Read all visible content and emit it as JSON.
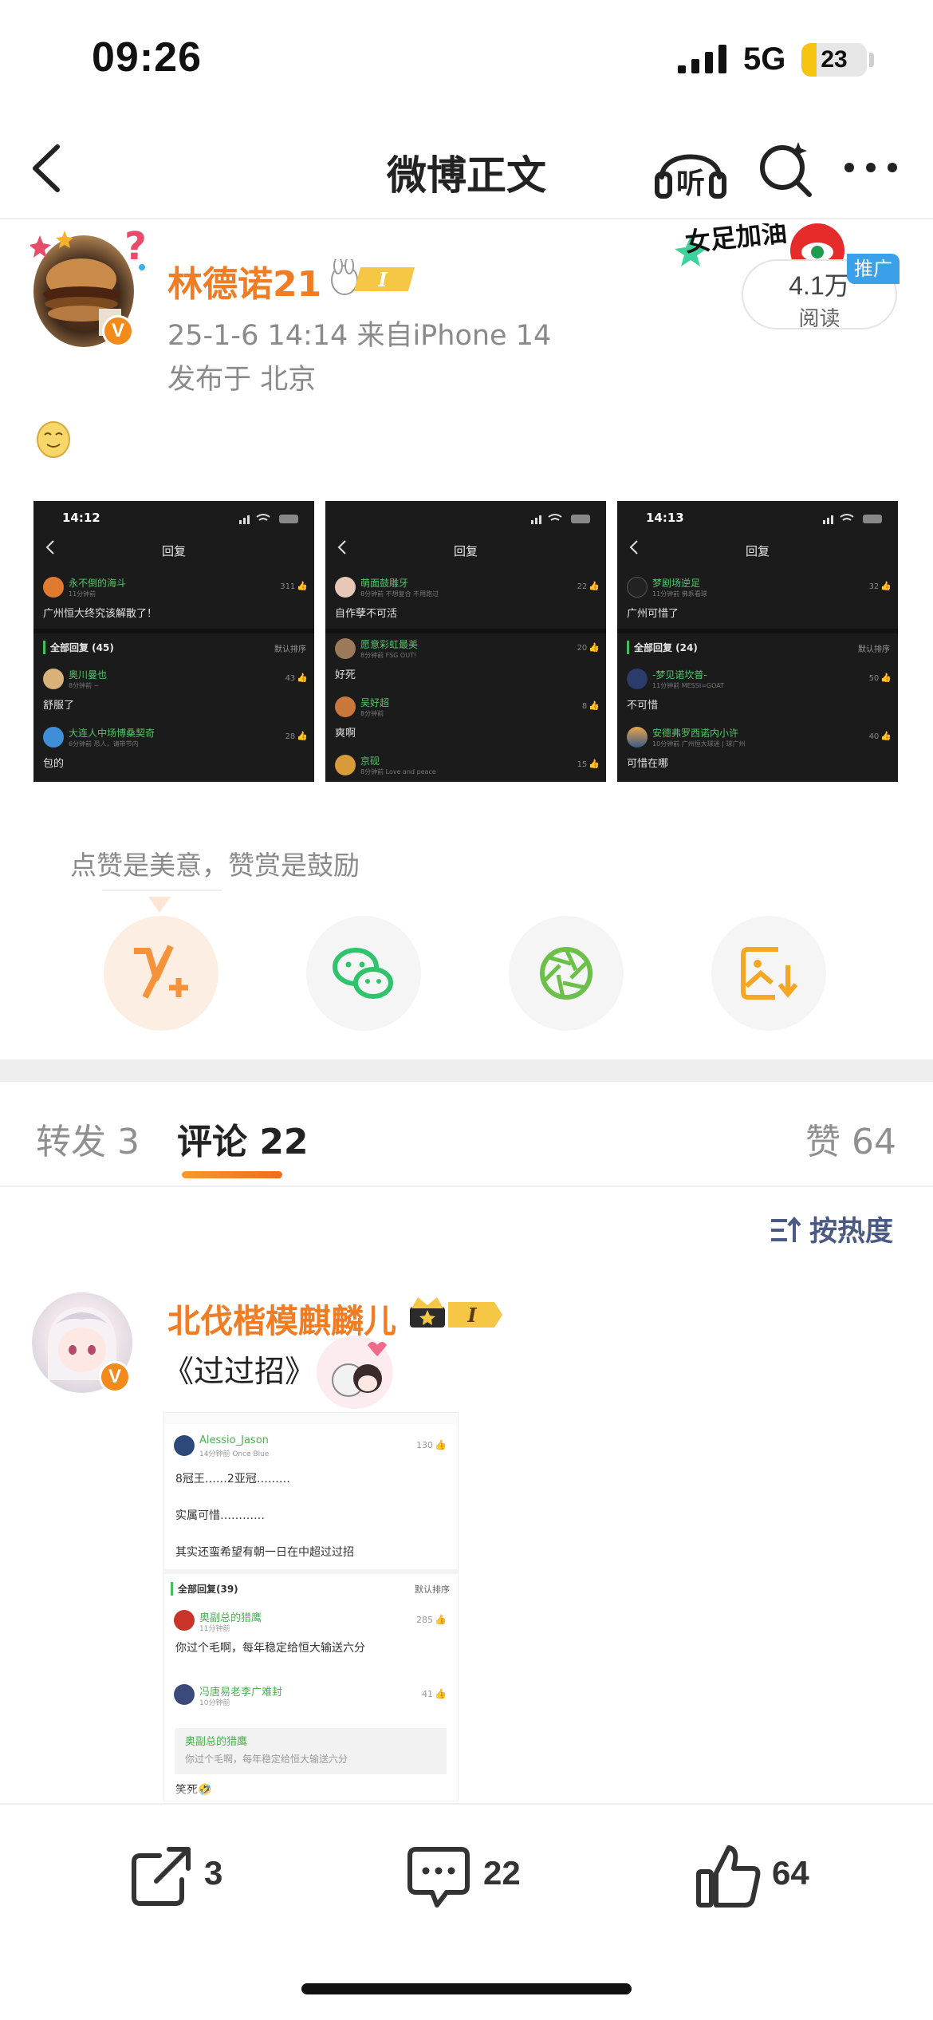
{
  "status_bar": {
    "time": "09:26",
    "network": "5G",
    "battery": "23",
    "battery_level": 0.23
  },
  "nav": {
    "title": "微博正文",
    "listen_label": "听",
    "back_icon": "chevron-left-icon",
    "search_icon": "search-sparkle-icon",
    "more_icon": "more-horizontal-icon"
  },
  "post": {
    "author": "林德诺21",
    "time_source": "25-1-6 14:14  来自iPhone 14",
    "location": "发布于 北京",
    "read_count": "4.1万",
    "read_label": "阅读",
    "ad_tag": "推广",
    "promo_sticker_text": "女足加油",
    "emoji": "smile-face-emoji",
    "images": [
      {
        "time": "14:12",
        "title": "回复",
        "top": {
          "name": "永不倒的海斗",
          "sub": "11分钟前",
          "likes": "311",
          "text": "广州恒大终究该解散了！"
        },
        "section": "全部回复 (45)",
        "sort": "默认排序",
        "replies": [
          {
            "name": "奥川曼也",
            "sub": "8分钟前 ~",
            "likes": "43",
            "text": "舒服了"
          },
          {
            "name": "大连人中场博桑契奇",
            "sub": "6分钟前 恐人，请带节内",
            "likes": "28",
            "text": "包的"
          }
        ]
      },
      {
        "time": "",
        "title": "回复",
        "top": {
          "name": "萌面鼓雕牙",
          "sub": "8分钟前 不想复合 不用跑过",
          "likes": "22",
          "text": "自作孽不可活"
        },
        "section": "",
        "sort": "",
        "replies": [
          {
            "name": "愿意彩虹最美",
            "sub": "8分钟前 FSG OUT!",
            "likes": "20",
            "text": "好死"
          },
          {
            "name": "吴好超",
            "sub": "8分钟前",
            "likes": "8",
            "text": "爽啊"
          },
          {
            "name": "京砚",
            "sub": "8分钟前 Love and peace",
            "likes": "15",
            "text": ""
          }
        ]
      },
      {
        "time": "14:13",
        "title": "回复",
        "top": {
          "name": "梦剧场逆足",
          "sub": "11分钟前 佛系看球",
          "likes": "32",
          "text": "广州可惜了"
        },
        "section": "全部回复 (24)",
        "sort": "默认排序",
        "replies": [
          {
            "name": "-梦见诺坎普-",
            "sub": "11分钟前 MESSI=GOAT",
            "likes": "50",
            "text": "不可惜"
          },
          {
            "name": "安德弗罗西诺内小许",
            "sub": "10分钟前 广州恒大球迷 | 球广州",
            "likes": "40",
            "text": "可惜在哪"
          }
        ]
      }
    ]
  },
  "reward": {
    "hint": "点赞是美意，赞赏是鼓励",
    "actions": [
      {
        "name": "reward-v-plus-icon",
        "color": "#f6933a"
      },
      {
        "name": "wechat-icon",
        "color": "#2fc46c"
      },
      {
        "name": "moments-aperture-icon",
        "color": "#6cc04a"
      },
      {
        "name": "save-image-icon",
        "color": "#f5a623"
      }
    ]
  },
  "tabs": {
    "repost": "转发 3",
    "comments": "评论 22",
    "likes": "赞 64"
  },
  "sort_label": "按热度",
  "comment": {
    "author": "北伐楷模麒麟儿",
    "text": "《过过招》",
    "image": {
      "top": {
        "name": "Alessio_Jason",
        "sub": "14分钟前 Once Blue",
        "likes": "130"
      },
      "lines": [
        "8冠王……2亚冠………",
        "实属可惜…………",
        "其实还蛮希望有朝一日在中超过过招"
      ],
      "section": "全部回复(39)",
      "sort": "默认排序",
      "reply1": {
        "name": "奥副总的猎鹰",
        "sub": "11分钟前",
        "likes": "285",
        "text": "你过个毛啊，每年稳定给恒大输送六分"
      },
      "reply2": {
        "name": "冯唐易老李广难封",
        "sub": "10分钟前",
        "likes": "41"
      },
      "quote_name": "奥副总的猎鹰",
      "quote_text": "你过个毛啊，每年稳定给恒大输送六分",
      "last_text": "笑死🤣"
    }
  },
  "bottom_bar": {
    "repost": "3",
    "comment": "22",
    "like": "64"
  },
  "colors": {
    "accent_orange": "#f07c24",
    "green_name": "#57c36c",
    "sort_blue": "#4a5a85"
  }
}
